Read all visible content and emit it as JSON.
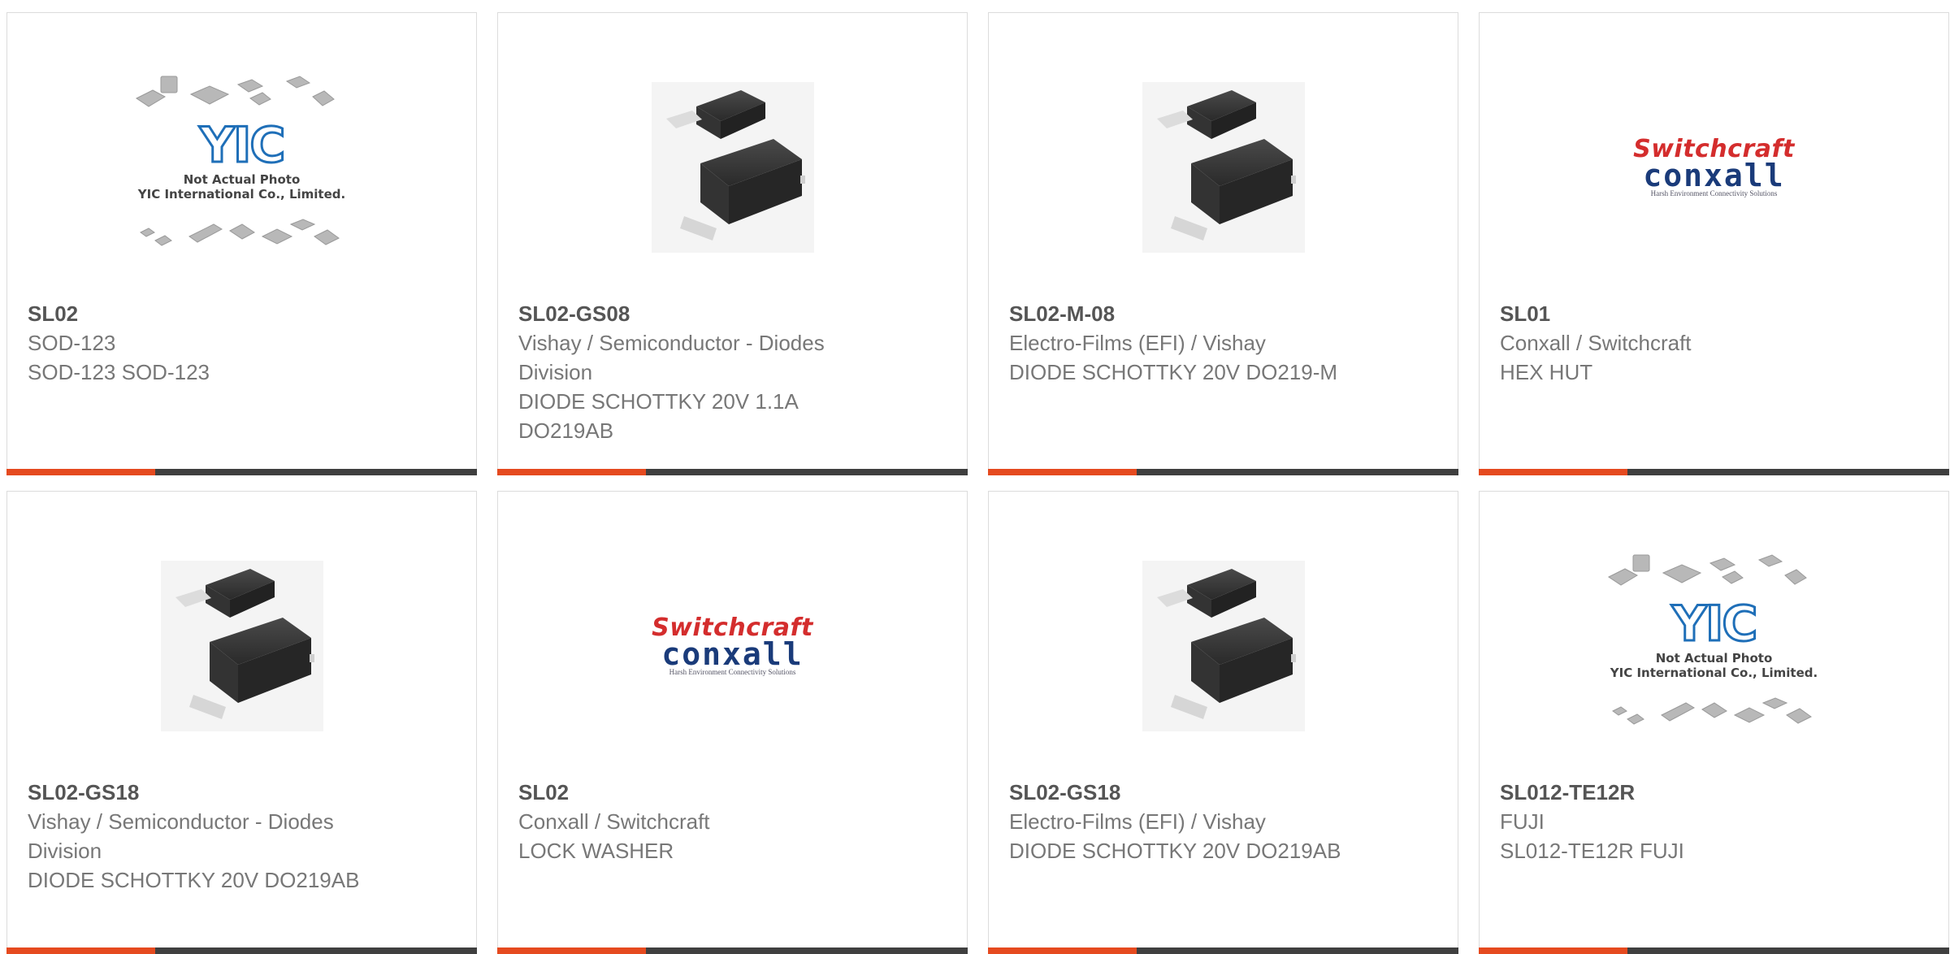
{
  "colors": {
    "accent": "#e54a1f",
    "bar": "#3f3f3f",
    "border": "#dcdcdc"
  },
  "products": [
    {
      "part": "SL02",
      "manufacturer": "SOD-123",
      "description": "SOD-123 SOD-123",
      "image": "yic-placeholder"
    },
    {
      "part": "SL02-GS08",
      "manufacturer": "Vishay / Semiconductor - Diodes Division",
      "description": "DIODE SCHOTTKY 20V 1.1A DO219AB",
      "image": "diode-package"
    },
    {
      "part": "SL02-M-08",
      "manufacturer": "Electro-Films (EFI) / Vishay",
      "description": "DIODE SCHOTTKY 20V DO219-M",
      "image": "diode-package"
    },
    {
      "part": "SL01",
      "manufacturer": "Conxall / Switchcraft",
      "description": "HEX HUT",
      "image": "switchcraft-logo"
    },
    {
      "part": "SL02-GS18",
      "manufacturer": "Vishay / Semiconductor - Diodes Division",
      "description": "DIODE SCHOTTKY 20V DO219AB",
      "image": "diode-package"
    },
    {
      "part": "SL02",
      "manufacturer": "Conxall / Switchcraft",
      "description": "LOCK WASHER",
      "image": "switchcraft-logo"
    },
    {
      "part": "SL02-GS18",
      "manufacturer": "Electro-Films (EFI) / Vishay",
      "description": "DIODE SCHOTTKY 20V DO219AB",
      "image": "diode-package"
    },
    {
      "part": "SL012-TE12R",
      "manufacturer": "FUJI",
      "description": "SL012-TE12R FUJI",
      "image": "yic-placeholder"
    }
  ],
  "yic": {
    "logo": "YIC",
    "note1": "Not Actual Photo",
    "note2": "YIC International Co., Limited."
  },
  "switchcraft": {
    "top": "Switchcraft",
    "bottom": "conxall",
    "tagline": "Harsh Environment Connectivity Solutions"
  }
}
